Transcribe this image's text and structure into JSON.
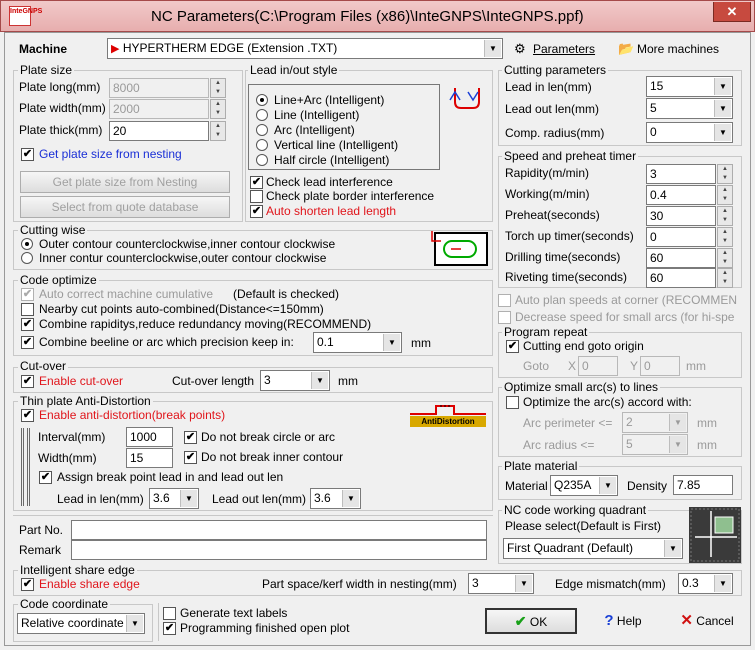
{
  "window": {
    "title": "NC Parameters(C:\\Program Files (x86)\\InteGNPS\\InteGNPS.ppf)",
    "logo_text": "InteGNPS",
    "close_glyph": "✕"
  },
  "machine": {
    "label": "Machine",
    "value": "HYPERTHERM EDGE (Extension .TXT)",
    "params_btn": "Parameters",
    "more_btn": "More machines"
  },
  "plate_size": {
    "legend": "Plate size",
    "long_label": "Plate long(mm)",
    "long_value": "8000",
    "width_label": "Plate width(mm)",
    "width_value": "2000",
    "thick_label": "Plate thick(mm)",
    "thick_value": "20",
    "get_from_nesting": "Get plate size from nesting",
    "get_btn": "Get plate size from Nesting",
    "quote_btn": "Select from quote database"
  },
  "lead_style": {
    "legend": "Lead in/out style",
    "options": [
      "Line+Arc (Intelligent)",
      "Line (Intelligent)",
      "Arc (Intelligent)",
      "Vertical line (Intelligent)",
      "Half circle (Intelligent)"
    ],
    "check_interference": "Check lead interference",
    "check_border": "Check plate border interference",
    "auto_shorten": "Auto shorten lead length"
  },
  "cutting_params": {
    "legend": "Cutting parameters",
    "lead_in_label": "Lead in len(mm)",
    "lead_in_value": "15",
    "lead_out_label": "Lead out len(mm)",
    "lead_out_value": "5",
    "comp_label": "Comp. radius(mm)",
    "comp_value": "0"
  },
  "speed": {
    "legend": "Speed and preheat timer",
    "rapidity_label": "Rapidity(m/min)",
    "rapidity_value": "3",
    "working_label": "Working(m/min)",
    "working_value": "0.4",
    "preheat_label": "Preheat(seconds)",
    "preheat_value": "30",
    "torch_label": "Torch up timer(seconds)",
    "torch_value": "0",
    "drilling_label": "Drilling time(seconds)",
    "drilling_value": "60",
    "riveting_label": "Riveting time(seconds)",
    "riveting_value": "60"
  },
  "auto_plan": "Auto plan speeds at corner (RECOMMEN",
  "decrease_speed": "Decrease speed for small arcs (for hi-spe",
  "cutting_wise": {
    "legend": "Cutting wise",
    "option1": "Outer contour counterclockwise,inner contour clockwise",
    "option2": "Inner contur counterclockwise,outer contour clockwise"
  },
  "program_repeat": {
    "legend": "Program repeat",
    "cutting_end": "Cutting end goto origin",
    "goto_label": "Goto",
    "x_label": "X",
    "x_value": "0",
    "y_label": "Y",
    "y_value": "0",
    "mm": "mm"
  },
  "code_optimize": {
    "legend": "Code optimize",
    "auto_correct": "Auto correct machine cumulative",
    "default_checked": "(Default is checked)",
    "nearby": "Nearby cut points auto-combined(Distance<=150mm)",
    "combine_rapid": "Combine rapiditys,reduce redundancy moving(RECOMMEND)",
    "combine_beeline": "Combine beeline or arc which precision keep in:",
    "precision_value": "0.1",
    "mm": "mm"
  },
  "optimize_arcs": {
    "legend": "Optimize small arc(s) to lines",
    "optimize": "Optimize the arc(s) accord with:",
    "perimeter_label": "Arc perimeter <=",
    "perimeter_value": "2",
    "radius_label": "Arc radius <=",
    "radius_value": "5",
    "mm": "mm"
  },
  "cut_over": {
    "legend": "Cut-over",
    "enable": "Enable cut-over",
    "length_label": "Cut-over length",
    "length_value": "3",
    "mm": "mm"
  },
  "thin_plate": {
    "legend": "Thin plate Anti-Distortion",
    "enable": "Enable anti-distortion(break points)",
    "interval_label": "Interval(mm)",
    "interval_value": "1000",
    "width_label": "Width(mm)",
    "width_value": "15",
    "no_break_circle": "Do not break circle or arc",
    "no_break_inner": "Do not break inner contour",
    "assign_break": "Assign break point lead in and lead out len",
    "lead_in_label": "Lead in len(mm)",
    "lead_in_value": "3.6",
    "lead_out_label": "Lead out len(mm)",
    "lead_out_value": "3.6",
    "badge": "AntiDistortion"
  },
  "plate_material": {
    "legend": "Plate material",
    "material_label": "Material",
    "material_value": "Q235A",
    "density_label": "Density",
    "density_value": "7.85"
  },
  "nc_quadrant": {
    "legend": "NC code working quadrant",
    "please_select": "Please select(Default is First)",
    "value": "First Quadrant (Default)"
  },
  "part_no_label": "Part No.",
  "remark_label": "Remark",
  "share_edge": {
    "legend": "Intelligent share edge",
    "enable": "Enable share edge",
    "part_space_label": "Part space/kerf width in nesting(mm)",
    "part_space_value": "3",
    "edge_mismatch_label": "Edge mismatch(mm)",
    "edge_mismatch_value": "0.3"
  },
  "code_coordinate": {
    "legend": "Code coordinate",
    "value": "Relative coordinate"
  },
  "generate_labels": "Generate text labels",
  "programming_finished": "Programming finished open plot",
  "buttons": {
    "ok": "OK",
    "help": "Help",
    "cancel": "Cancel"
  },
  "glyphs": {
    "check": "✔",
    "arrow_down": "▼",
    "arrow_up": "▲"
  },
  "colors": {
    "accent_red": "#e0151b",
    "link_blue": "#1a2fd6",
    "title_bar": "#e7aeae"
  }
}
